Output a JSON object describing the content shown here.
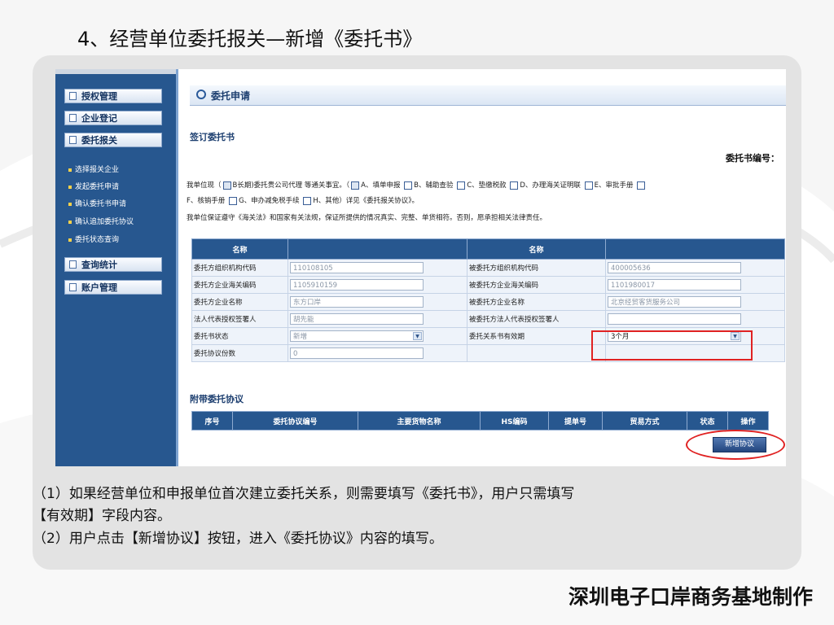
{
  "slide": {
    "title": "4、经营单位委托报关—新增《委托书》",
    "notes": [
      "（1）如果经营单位和申报单位首次建立委托关系，则需要填写《委托书》，用户只需填写",
      "【有效期】字段内容。",
      "（2）用户点击【新增协议】按钮，进入《委托协议》内容的填写。"
    ],
    "footer": "深圳电子口岸商务基地制作"
  },
  "sidebar": {
    "menus": [
      {
        "label": "授权管理"
      },
      {
        "label": "企业登记"
      },
      {
        "label": "委托报关"
      },
      {
        "label": "查询统计"
      },
      {
        "label": "账户管理"
      }
    ],
    "subitems": [
      {
        "label": "选择报关企业"
      },
      {
        "label": "发起委托申请"
      },
      {
        "label": "确认委托书申请"
      },
      {
        "label": "确认追加委托协议"
      },
      {
        "label": "委托状态查询"
      }
    ]
  },
  "form": {
    "header": "委托申请",
    "section_sign": "签订委托书",
    "number_label": "委托书编号：",
    "para1a_pre": "我单位现（",
    "para1a_mid": "B长期)委托贵公司代理 等通关事宜。（",
    "opt_a": "A、填单申报",
    "opt_b": "B、辅助查验",
    "opt_c": "C、垫缴税款",
    "opt_d": "D、办理海关证明联",
    "opt_e": "E、审批手册",
    "opt_f": "F、核销手册",
    "opt_g": "G、申办减免税手续",
    "opt_h": "H、其他",
    "para1b_tail": "）详见《委托报关协议》。",
    "para2": "我单位保证遵守《海关法》和国家有关法规，保证所提供的情况真实、完整、单货相符。否则，愿承担相关法律责任。",
    "table_headers": [
      "名称",
      "",
      "名称",
      ""
    ],
    "rows": [
      {
        "l1": "委托方组织机构代码",
        "v1": "110108105",
        "l2": "被委托方组织机构代码",
        "v2": "400005636"
      },
      {
        "l1": "委托方企业海关编码",
        "v1": "1105910159",
        "l2": "被委托方企业海关编码",
        "v2": "1101980017"
      },
      {
        "l1": "委托方企业名称",
        "v1": "东方口岸",
        "l2": "被委托方企业名称",
        "v2": "北京经贸客货服务公司"
      },
      {
        "l1": "法人代表授权签署人",
        "v1": "胡先能",
        "l2": "被委托方法人代表授权签署人",
        "v2": ""
      },
      {
        "l1": "委托书状态",
        "v1": "新增",
        "l2": "委托关系书有效期",
        "v2": "3个月"
      },
      {
        "l1": "委托协议份数",
        "v1": "0",
        "l2": "",
        "v2": ""
      }
    ],
    "section_attach": "附带委托协议",
    "agreement_headers": [
      "序号",
      "委托协议编号",
      "主要货物名称",
      "HS编码",
      "提单号",
      "贸易方式",
      "状态",
      "操作"
    ],
    "add_button": "新增协议"
  }
}
